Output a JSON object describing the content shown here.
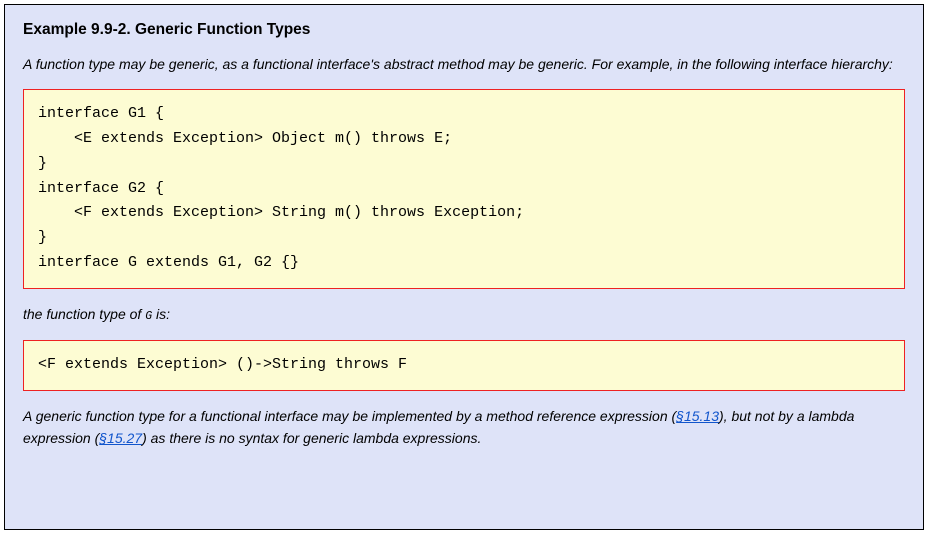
{
  "example": {
    "title": "Example 9.9-2. Generic Function Types",
    "intro": "A function type may be generic, as a functional interface's abstract method may be generic. For example, in the following interface hierarchy:",
    "code1": "interface G1 {\n    <E extends Exception> Object m() throws E;\n}\ninterface G2 {\n    <F extends Exception> String m() throws Exception;\n}\ninterface G extends G1, G2 {}",
    "mid_pre": "the function type of ",
    "mid_code": "G",
    "mid_post": " is:",
    "code2": "<F extends Exception> ()->String throws F",
    "outro_1": "A generic function type for a functional interface may be implemented by a method reference expression (",
    "link1": "§15.13",
    "outro_2": "), but not by a lambda expression (",
    "link2": "§15.27",
    "outro_3": ") as there is no syntax for generic lambda expressions."
  }
}
